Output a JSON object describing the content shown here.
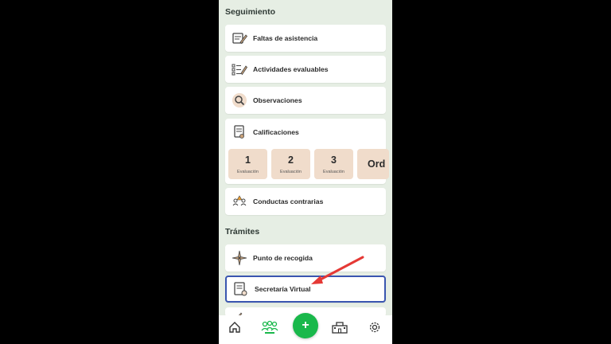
{
  "sections": {
    "seguimiento": "Seguimiento",
    "tramites": "Trámites"
  },
  "items": {
    "faltas": "Faltas de asistencia",
    "actividades": "Actividades evaluables",
    "observaciones": "Observaciones",
    "calificaciones": "Calificaciones",
    "conductas": "Conductas contrarias",
    "punto_recogida": "Punto de recogida",
    "secretaria": "Secretaría Virtual"
  },
  "grades": [
    {
      "num": "1",
      "label": "Evaluación"
    },
    {
      "num": "2",
      "label": "Evaluación"
    },
    {
      "num": "3",
      "label": "Evaluación"
    },
    {
      "num": "Ord",
      "label": ""
    }
  ],
  "fab_label": "+",
  "icons": {
    "faltas": "pencil-calendar-icon",
    "actividades": "checklist-pencil-icon",
    "observaciones": "magnifier-icon",
    "calificaciones": "certificate-icon",
    "conductas": "warning-people-icon",
    "punto_recogida": "compass-star-icon",
    "secretaria": "document-seal-icon",
    "nav_home": "home-icon",
    "nav_students": "students-icon",
    "nav_school": "school-icon",
    "nav_settings": "gear-icon"
  },
  "colors": {
    "background": "#e6eee4",
    "accent_green": "#19b84b",
    "highlight_border": "#3a56b0",
    "grade_tile": "#f0dccb",
    "annotation_arrow": "#e53935"
  }
}
